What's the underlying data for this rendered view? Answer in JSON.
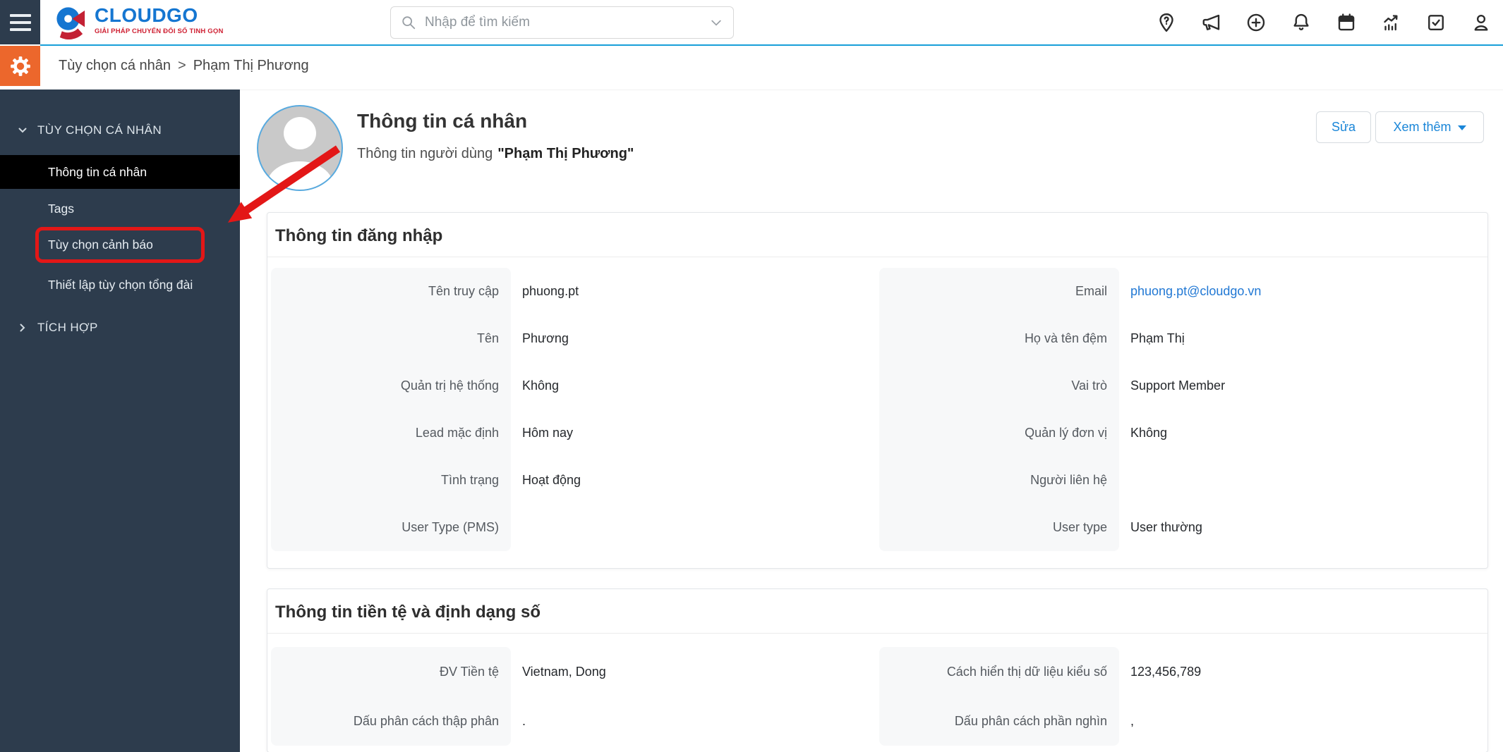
{
  "topbar": {
    "logo": {
      "brand": "CLOUDGO",
      "tagline": "GIẢI PHÁP CHUYỂN ĐỔI SỐ TINH GỌN"
    },
    "search": {
      "placeholder": "Nhập để tìm kiếm"
    },
    "icons": [
      "location-question-icon",
      "megaphone-icon",
      "plus-circle-icon",
      "bell-icon",
      "calendar-icon",
      "analytics-icon",
      "tasks-checkbox-icon",
      "user-icon"
    ]
  },
  "breadcrumb": {
    "section": "Tùy chọn cá nhân",
    "separator": ">",
    "current": "Phạm Thị Phương"
  },
  "sidebar": {
    "sections": [
      {
        "label": "TÙY CHỌN CÁ NHÂN",
        "expanded": true,
        "items": [
          {
            "label": "Thông tin cá nhân",
            "active": true
          },
          {
            "label": "Tags"
          },
          {
            "label": "Tùy chọn cảnh báo",
            "highlighted": true
          },
          {
            "label": "Thiết lập tùy chọn tổng đài"
          }
        ]
      },
      {
        "label": "TÍCH HỢP",
        "expanded": false,
        "items": []
      }
    ]
  },
  "header": {
    "title": "Thông tin cá nhân",
    "subtitle_prefix": "Thông tin người dùng",
    "subtitle_name": "\"Phạm Thị Phương\"",
    "edit_button": "Sửa",
    "more_button": "Xem thêm"
  },
  "cards": [
    {
      "title": "Thông tin đăng nhập",
      "columns": [
        {
          "fields": [
            {
              "label": "Tên truy cập",
              "value": "phuong.pt"
            },
            {
              "label": "Tên",
              "value": "Phương"
            },
            {
              "label": "Quản trị hệ thống",
              "value": "Không"
            },
            {
              "label": "Lead mặc định",
              "value": "Hôm nay"
            },
            {
              "label": "Tình trạng",
              "value": "Hoạt động"
            },
            {
              "label": "User Type (PMS)",
              "value": ""
            }
          ]
        },
        {
          "fields": [
            {
              "label": "Email",
              "value": "phuong.pt@cloudgo.vn",
              "link": true
            },
            {
              "label": "Họ và tên đệm",
              "value": "Phạm Thị"
            },
            {
              "label": "Vai trò",
              "value": "Support Member"
            },
            {
              "label": "Quản lý đơn vị",
              "value": "Không"
            },
            {
              "label": "Người liên hệ",
              "value": ""
            },
            {
              "label": "User type",
              "value": "User thường"
            }
          ]
        }
      ]
    },
    {
      "title": "Thông tin tiền tệ và định dạng số",
      "columns": [
        {
          "fields": [
            {
              "label": "ĐV Tiền tệ",
              "value": "Vietnam, Dong"
            },
            {
              "label": "Dấu phân cách thập phân",
              "value": "."
            }
          ]
        },
        {
          "fields": [
            {
              "label": "Cách hiển thị dữ liệu kiểu số",
              "value": "123,456,789"
            },
            {
              "label": "Dấu phân cách phần nghìn",
              "value": ","
            }
          ]
        }
      ]
    }
  ],
  "colors": {
    "sidebar_bg": "#2d3c4d",
    "active_item_bg": "#000000",
    "orange": "#ec672c",
    "topbar_divider": "#189fd9",
    "link_blue": "#2178d4",
    "button_blue": "#1a86d8",
    "annotation_red": "#e31717",
    "brand_blue": "#1576d1",
    "brand_red": "#cf2133"
  }
}
